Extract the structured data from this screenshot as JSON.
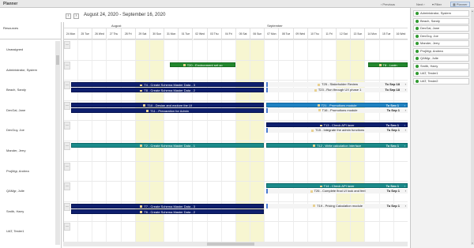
{
  "window": {
    "title": "Planner"
  },
  "toolbar": {
    "previous": "Previous",
    "next": "Next",
    "filter": "Filter",
    "planner": "Planner"
  },
  "nav": {
    "range": "August 24, 2020 - September 16, 2020"
  },
  "resources_header": "Resources",
  "months": [
    {
      "label": "August"
    },
    {
      "label": "September"
    }
  ],
  "days": [
    "24 Mon",
    "25 Tue",
    "26 Wed",
    "27 Thu",
    "28 Fri",
    "29 Sat",
    "30 Sun",
    "31 Mon",
    "01 Tue",
    "02 Wed",
    "03 Thu",
    "04 Fri",
    "05 Sat",
    "06 Sun",
    "07 Mon",
    "08 Tue",
    "09 Wed",
    "10 Thu",
    "11 Fri",
    "12 Sat",
    "13 Sun",
    "14 Mon",
    "15 Tue",
    "16 Wed"
  ],
  "weekend_days": [
    5,
    6,
    12,
    13,
    19,
    20
  ],
  "resources": [
    "Unassigned",
    "Administrator, System",
    "Beach, Sandy",
    "DevGal, Jane",
    "DevGuy, Joe",
    "Mander, Jerry",
    "ProjMgr, Andrea",
    "QAMgr, Julie",
    "Smith, Harry",
    "UAT, Tester1"
  ],
  "tasks": [
    {
      "label": "T20 - Environment set up",
      "color": "green",
      "date": "",
      "start": 7.4,
      "end": 12,
      "row": 1,
      "sub": 0
    },
    {
      "label": "T8 - Login",
      "color": "green",
      "date": "",
      "start": 21.2,
      "end": 24,
      "row": 1,
      "sub": 0
    },
    {
      "label": "T4 - Create Schema Master Data - 3",
      "color": "navy",
      "date": "",
      "start": 0,
      "end": 14,
      "row": 2,
      "sub": 0
    },
    {
      "label": "T8 - Create Schema Master Data - 2",
      "color": "navy",
      "date": "",
      "start": 0,
      "end": 14,
      "row": 2,
      "sub": 1
    },
    {
      "label": "T25 - Stakeholder Review",
      "color": "light",
      "date": "To Sep 18",
      "start": 14.1,
      "end": 24,
      "row": 2,
      "sub": 0
    },
    {
      "label": "T23 - Run through UX phase 1",
      "color": "light",
      "date": "To Sep 18",
      "start": 14.1,
      "end": 24,
      "row": 2,
      "sub": 1
    },
    {
      "label": "T10 - Design and explore the UI",
      "color": "navy",
      "date": "",
      "start": 0,
      "end": 14,
      "row": 3,
      "sub": 0
    },
    {
      "label": "T11 - Preparation for Admin",
      "color": "navy",
      "date": "",
      "start": 0,
      "end": 14,
      "row": 3,
      "sub": 1
    },
    {
      "label": "T21 - Promotions module",
      "color": "blue",
      "date": "To Sep 1",
      "start": 14.1,
      "end": 24,
      "row": 3,
      "sub": 0
    },
    {
      "label": "T16 - Promotions module",
      "color": "light",
      "date": "To Sep 1",
      "start": 14.1,
      "end": 24,
      "row": 3,
      "sub": 1
    },
    {
      "label": "T13 - Check API layer",
      "color": "navy",
      "date": "To Sep 1",
      "start": 14.1,
      "end": 24,
      "row": 4,
      "sub": 0
    },
    {
      "label": "T15 - Integrate the admin functions",
      "color": "light",
      "date": "To Sep 1",
      "start": 14.1,
      "end": 24,
      "row": 4,
      "sub": 1
    },
    {
      "label": "T2 - Create Schema Master Data - 1",
      "color": "teal",
      "date": "",
      "start": 0,
      "end": 14,
      "row": 5,
      "sub": 0
    },
    {
      "label": "T12 - Write calculation interface",
      "color": "teal",
      "date": "To Sep 1",
      "start": 14.1,
      "end": 24,
      "row": 5,
      "sub": 0
    },
    {
      "label": "T14 - Check API layer",
      "color": "teal",
      "date": "To Sep 1",
      "start": 14.1,
      "end": 24,
      "row": 7,
      "sub": 0
    },
    {
      "label": "T26 - Complete final UI look and feel",
      "color": "light",
      "date": "To Sep 1",
      "start": 14.1,
      "end": 24,
      "row": 7,
      "sub": 1
    },
    {
      "label": "T7 - Create Schema Master Data - 3",
      "color": "navy",
      "date": "",
      "start": 0,
      "end": 14,
      "row": 8,
      "sub": 0
    },
    {
      "label": "T6 - Create Schema Master Data - 2",
      "color": "navy",
      "date": "",
      "start": 0,
      "end": 14,
      "row": 8,
      "sub": 1
    },
    {
      "label": "T19 - Pricing Calculation module",
      "color": "light",
      "date": "To Sep 1",
      "start": 14.1,
      "end": 24,
      "row": 8,
      "sub": 0
    }
  ],
  "panel": {
    "items": [
      "Administrator, System",
      "Beach, Sandy",
      "DevGal, Jane",
      "DevGuy, Joe",
      "Mander, Jerry",
      "ProjMgr, Andrea",
      "QAMgr, Julie",
      "Smith, Harry",
      "UAT, Tester1",
      "UAT, Tester2"
    ]
  },
  "colors": {
    "navy": "#0e1f6e",
    "teal": "#1a8a8a",
    "green": "#23872e",
    "blue": "#1f82c2",
    "weekend": "#f7f6d1"
  }
}
